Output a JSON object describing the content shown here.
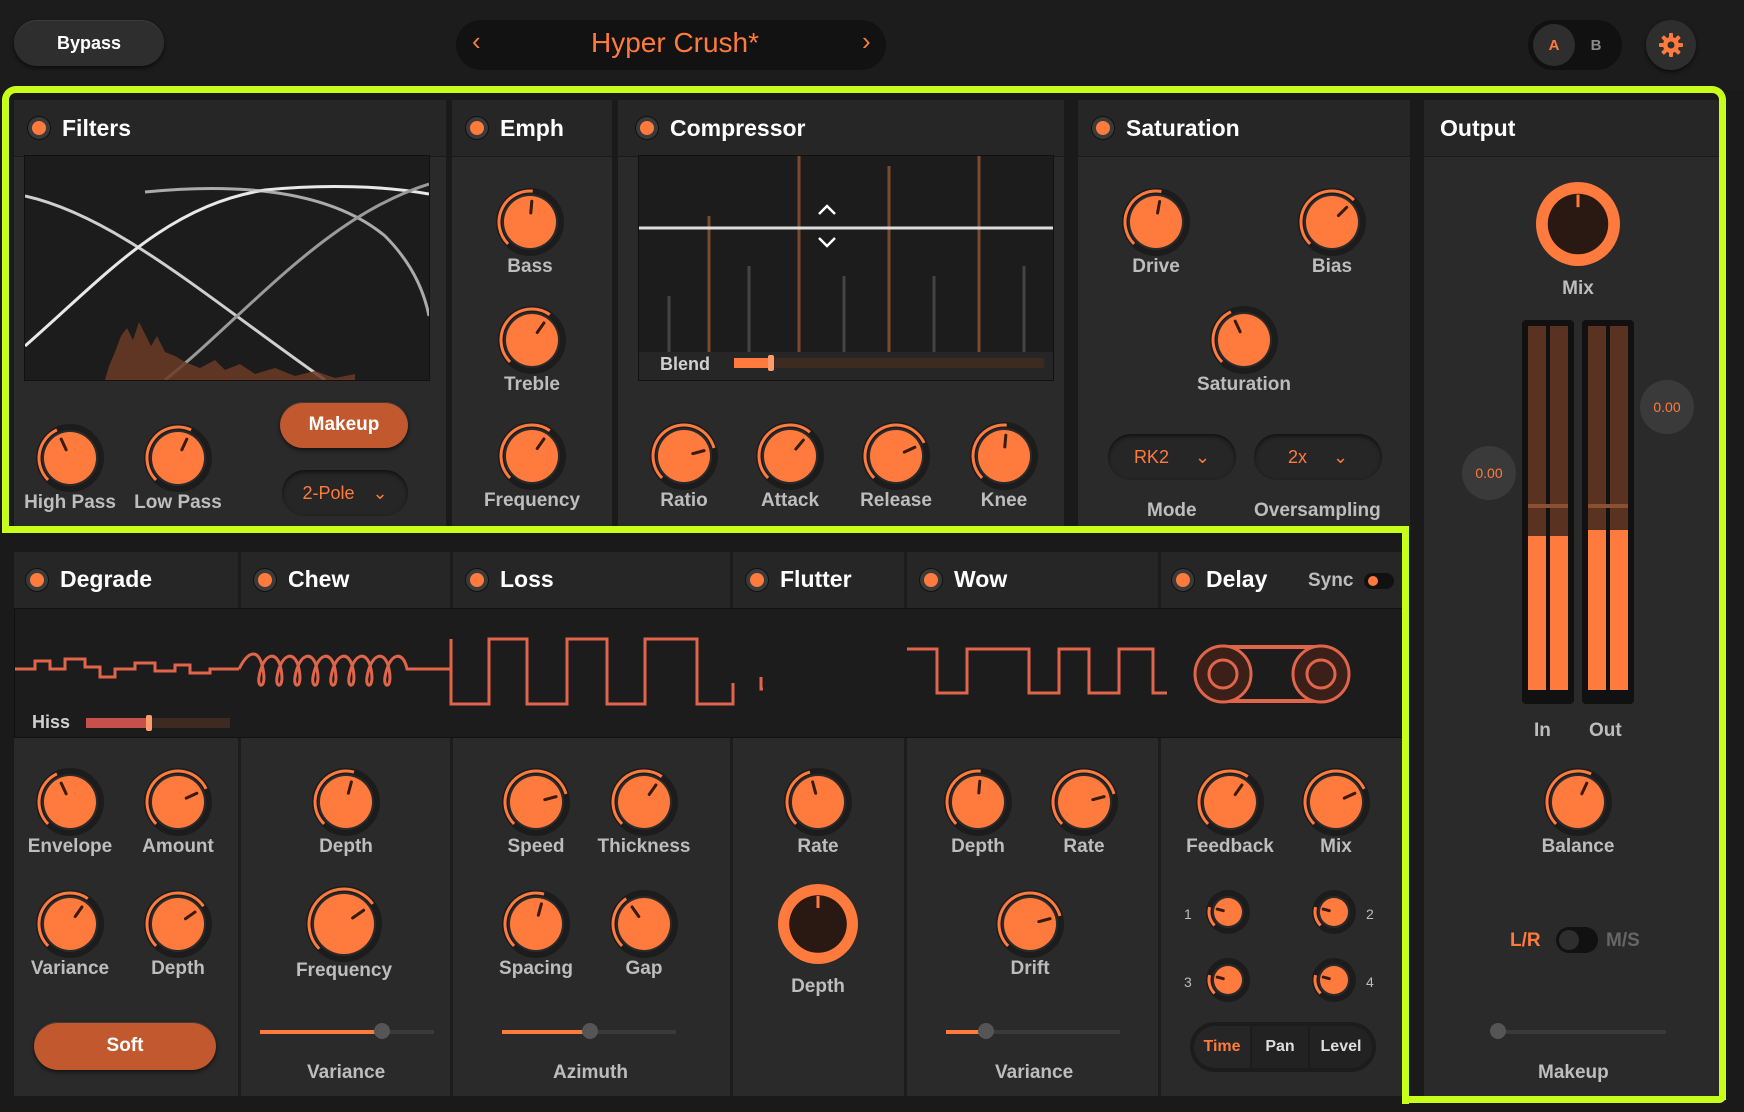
{
  "topbar": {
    "bypass": "Bypass",
    "preset_name": "Hyper Crush*",
    "prev": "‹",
    "next": "›",
    "ab_a": "A",
    "ab_b": "B"
  },
  "modules_top": {
    "filters": {
      "title": "Filters",
      "knobs": [
        "High Pass",
        "Low Pass"
      ],
      "makeup": "Makeup",
      "pole": "2-Pole"
    },
    "emph": {
      "title": "Emph",
      "knobs": [
        "Bass",
        "Treble",
        "Frequency"
      ]
    },
    "compressor": {
      "title": "Compressor",
      "blend": "Blend",
      "knobs": [
        "Ratio",
        "Attack",
        "Release",
        "Knee"
      ]
    },
    "saturation": {
      "title": "Saturation",
      "knobs": [
        "Drive",
        "Bias",
        "Saturation"
      ],
      "mode_value": "RK2",
      "oversampling_value": "2x",
      "mode_label": "Mode",
      "oversampling_label": "Oversampling"
    }
  },
  "output": {
    "title": "Output",
    "mix": "Mix",
    "in": "In",
    "out": "Out",
    "in_value": "0.00",
    "out_value": "0.00",
    "balance": "Balance",
    "lr": "L/R",
    "ms": "M/S",
    "makeup": "Makeup"
  },
  "modules_bottom": {
    "degrade": {
      "title": "Degrade",
      "hiss": "Hiss",
      "knobs": [
        "Envelope",
        "Amount",
        "Variance",
        "Depth"
      ],
      "soft": "Soft"
    },
    "chew": {
      "title": "Chew",
      "knobs": [
        "Depth",
        "Frequency"
      ],
      "variance": "Variance"
    },
    "loss": {
      "title": "Loss",
      "knobs": [
        "Speed",
        "Thickness",
        "Spacing",
        "Gap"
      ],
      "azimuth": "Azimuth"
    },
    "flutter": {
      "title": "Flutter",
      "knobs": [
        "Rate",
        "Depth"
      ]
    },
    "wow": {
      "title": "Wow",
      "knobs": [
        "Depth",
        "Rate",
        "Drift"
      ],
      "variance": "Variance"
    },
    "delay": {
      "title": "Delay",
      "sync": "Sync",
      "knobs": [
        "Feedback",
        "Mix"
      ],
      "taps": [
        "1",
        "2",
        "3",
        "4"
      ],
      "tabs": [
        "Time",
        "Pan",
        "Level"
      ]
    }
  },
  "colors": {
    "accent": "#ff7a3d",
    "highlight": "#c8ff1a",
    "panel": "#2a2a2a"
  }
}
